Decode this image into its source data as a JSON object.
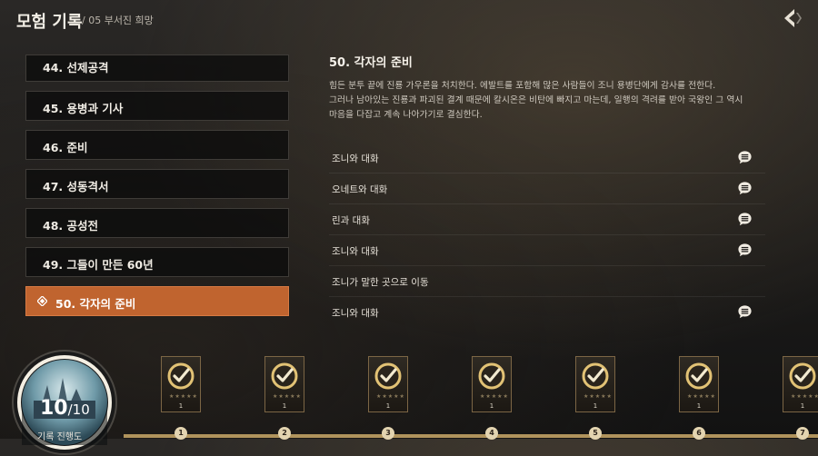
{
  "header": {
    "title": "모험 기록",
    "subtitle": "/ 05 부서진 희망"
  },
  "chapters": [
    {
      "label": "44. 선제공격",
      "active": false
    },
    {
      "label": "45. 용병과 기사",
      "active": false
    },
    {
      "label": "46. 준비",
      "active": false
    },
    {
      "label": "47. 성동격서",
      "active": false
    },
    {
      "label": "48. 공성전",
      "active": false
    },
    {
      "label": "49. 그들이 만든 60년",
      "active": false
    },
    {
      "label": "50. 각자의 준비",
      "active": true
    }
  ],
  "detail": {
    "title": "50. 각자의 준비",
    "description": "힘든 분투 끝에 진룡 가우론을 처치한다. 에발트를 포함해 많은 사람들이 조니 용병단에게 감사를 전한다.\n그러나 남아있는 진룡과 파괴된 결계 때문에 칼시온은 비탄에 빠지고 마는데, 일행의 격려를 받아 국왕인 그 역시\n마음을 다잡고 계속 나아가기로 결심한다."
  },
  "tasks": [
    {
      "label": "조니와 대화",
      "icon": "chat-bubble-icon"
    },
    {
      "label": "오네트와 대화",
      "icon": "chat-bubble-icon"
    },
    {
      "label": "린과 대화",
      "icon": "chat-bubble-icon"
    },
    {
      "label": "조니와 대화",
      "icon": "chat-bubble-icon"
    },
    {
      "label": "조니가 말한 곳으로 이동",
      "icon": ""
    },
    {
      "label": "조니와 대화",
      "icon": "chat-bubble-icon"
    }
  ],
  "progress": {
    "current": "10",
    "total": "/10",
    "label": "기록 진행도",
    "fraction": 1.0
  },
  "rewards": [
    {
      "count": "1",
      "number": "1",
      "icon": "check-badge-icon"
    },
    {
      "count": "1",
      "number": "2",
      "icon": "check-badge-icon"
    },
    {
      "count": "1",
      "number": "3",
      "icon": "check-badge-icon"
    },
    {
      "count": "1",
      "number": "4",
      "icon": "check-badge-icon"
    },
    {
      "count": "1",
      "number": "5",
      "icon": "check-badge-icon"
    },
    {
      "count": "1",
      "number": "6",
      "icon": "check-badge-icon"
    },
    {
      "count": "1",
      "number": "7",
      "icon": "check-badge-icon"
    }
  ],
  "colors": {
    "accent": "#c0642f",
    "gold": "#d9b462"
  }
}
